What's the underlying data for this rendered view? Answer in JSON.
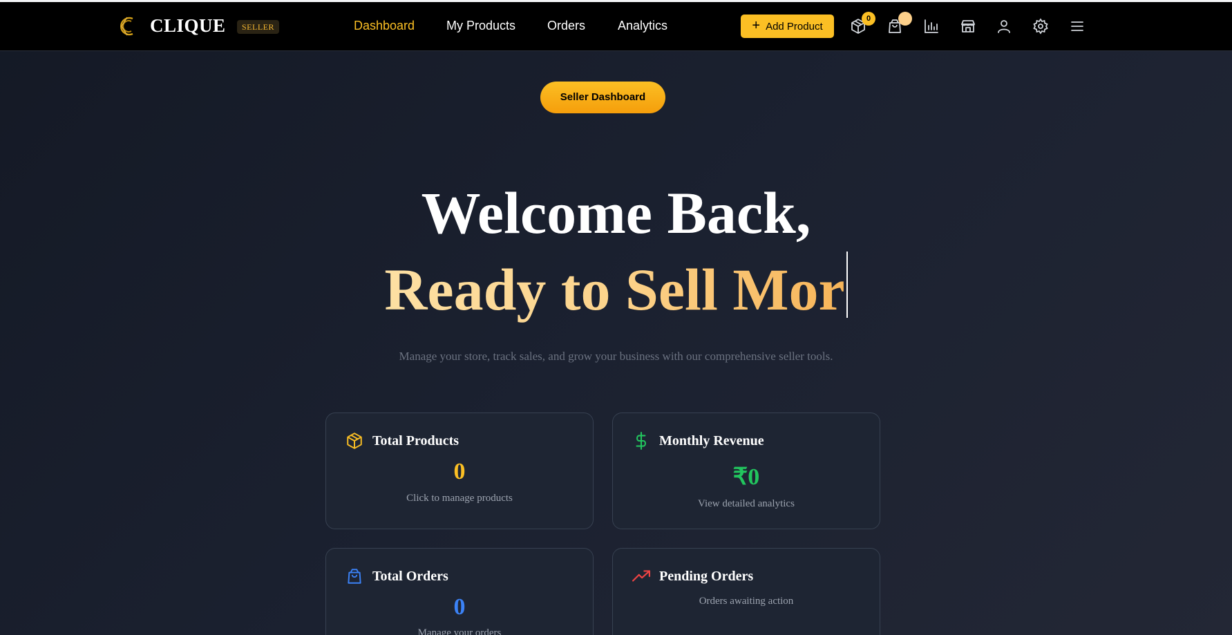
{
  "colors": {
    "accent": "#fbbf24",
    "navbar_bg": "#000000",
    "page_bg": "#1b2130",
    "card_bg": "#1e2533",
    "green": "#22c55e",
    "blue": "#3b82f6",
    "red": "#ef4444"
  },
  "navbar": {
    "brand": "CLIQUE",
    "badge": "SELLER",
    "links": [
      "Dashboard",
      "My Products",
      "Orders",
      "Analytics"
    ],
    "active_link": "Dashboard",
    "add_product_label": "Add Product",
    "products_count": "0",
    "icons": [
      "package-icon",
      "shopping-bag-icon",
      "bar-chart-icon",
      "store-icon",
      "user-icon",
      "settings-icon",
      "menu-icon"
    ]
  },
  "hero": {
    "pill_label": "Seller Dashboard",
    "line1": "Welcome Back,",
    "line2": "Ready to Sell Mor",
    "subtitle": "Manage your store, track sales, and grow your business with our comprehensive seller tools."
  },
  "cards": [
    {
      "icon": "package-icon",
      "title": "Total Products",
      "value": "0",
      "desc": "Click to manage products",
      "color": "#fbbf24"
    },
    {
      "icon": "dollar-icon",
      "title": "Monthly Revenue",
      "value": "₹0",
      "desc": "View detailed analytics",
      "color": "#22c55e"
    },
    {
      "icon": "shopping-bag-icon",
      "title": "Total Orders",
      "value": "0",
      "desc": "Manage your orders",
      "color": "#3b82f6"
    },
    {
      "icon": "trending-up-icon",
      "title": "Pending Orders",
      "value": "",
      "desc": "Orders awaiting action",
      "color": "#ef4444"
    }
  ]
}
